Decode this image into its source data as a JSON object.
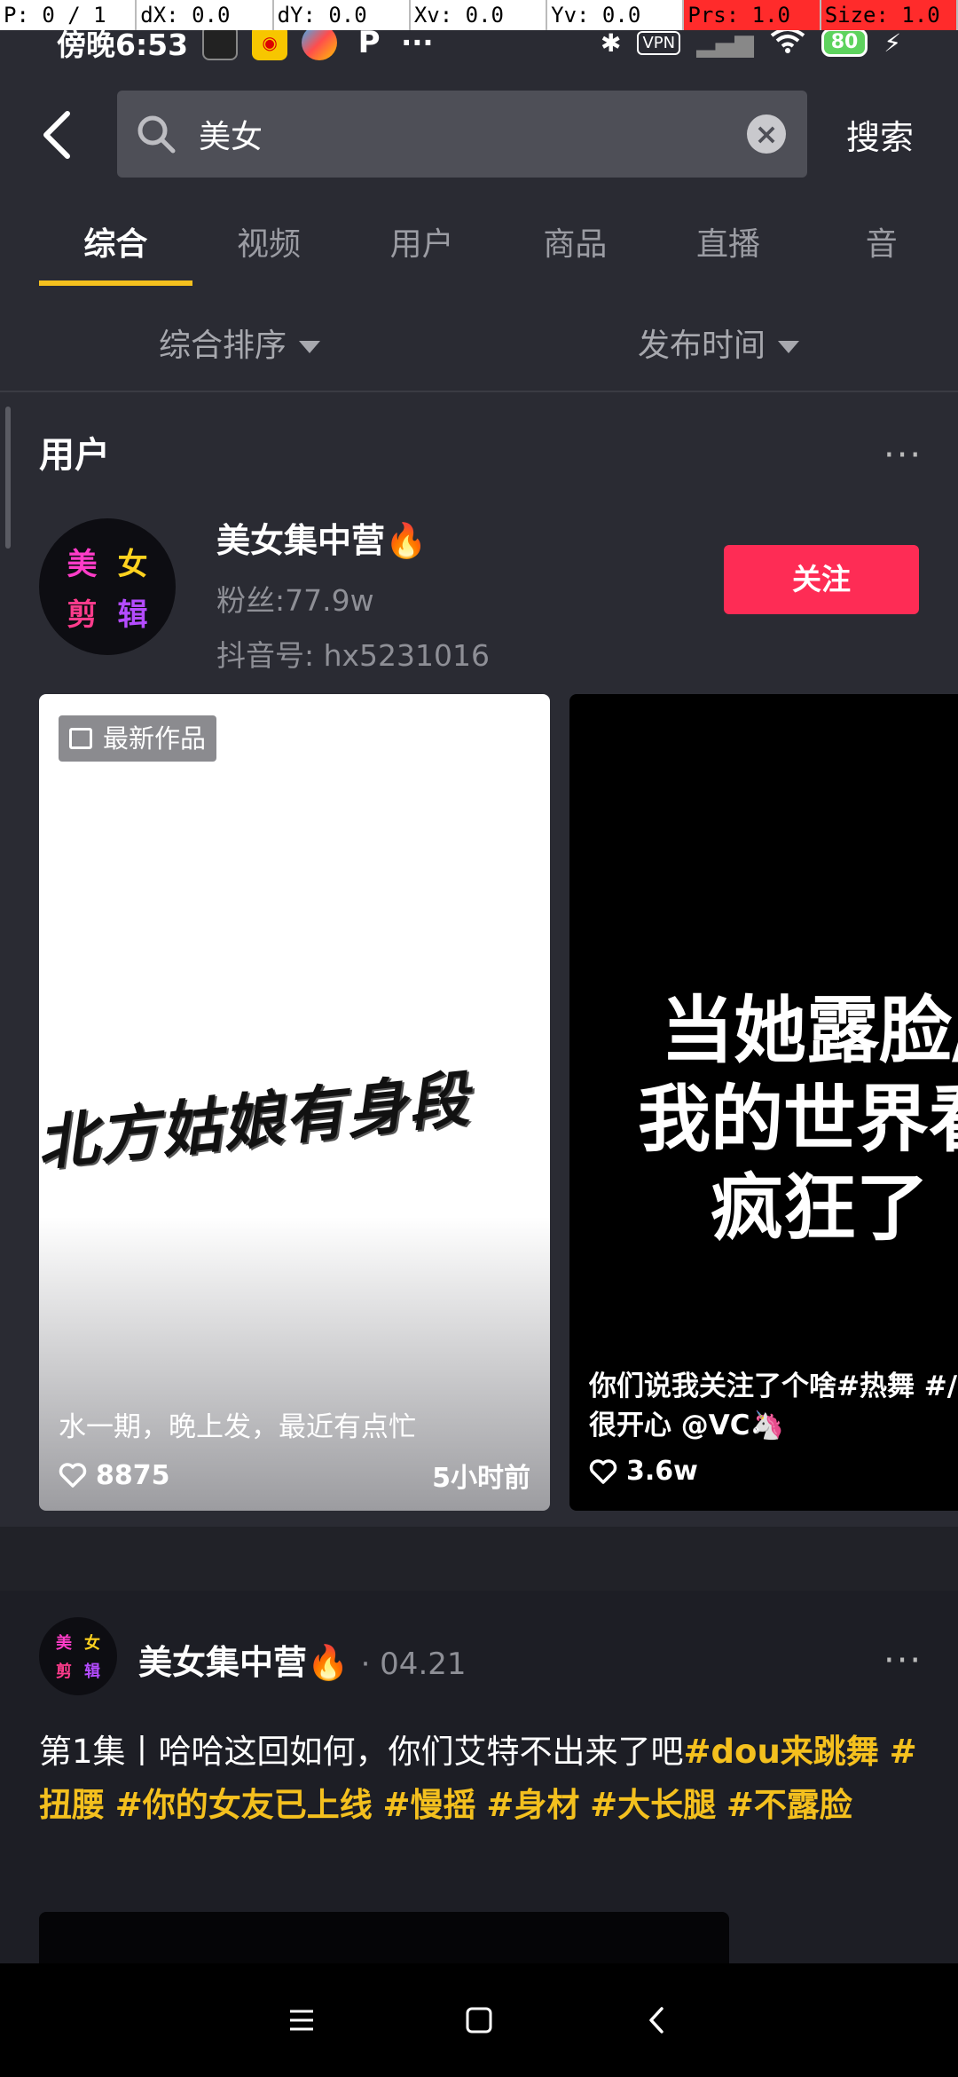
{
  "debug": {
    "p": "P: 0 / 1",
    "dx": "dX: 0.0",
    "dy": "dY: 0.0",
    "xv": "Xv: 0.0",
    "yv": "Yv: 0.0",
    "prs": "Prs: 1.0",
    "size": "Size: 1.0"
  },
  "status": {
    "time": "傍晚6:53",
    "vpn": "VPN",
    "battery": "80",
    "more": "···",
    "p_icon": "P"
  },
  "search": {
    "query": "美女",
    "submit_label": "搜索"
  },
  "tabs": [
    "综合",
    "视频",
    "用户",
    "商品",
    "直播",
    "音"
  ],
  "filters": {
    "sort": "综合排序",
    "time": "发布时间"
  },
  "users_section": {
    "title": "用户",
    "user": {
      "name": "美女集中营🔥",
      "fans": "粉丝:77.9w",
      "id": "抖音号: hx5231016",
      "follow_label": "关注",
      "avatar_chars": [
        "美",
        "女",
        "剪",
        "辑"
      ]
    },
    "cards": [
      {
        "badge": "最新作品",
        "overlay_text": "北方姑娘有身段",
        "caption": "水一期，晚上发，最近有点忙",
        "likes": "8875",
        "time": "5小时前"
      },
      {
        "overlay_lines": [
          "当她露脸/",
          "我的世界看",
          "疯狂了"
        ],
        "caption_line1": "你们说我关注了个啥#热舞 #/",
        "caption_line2": "很开心 @VC🦄",
        "likes": "3.6w"
      }
    ]
  },
  "post": {
    "author": "美女集中营🔥",
    "date": "· 04.21",
    "text_plain": "第1集丨哈哈这回如何，你们艾特不出来了吧",
    "tags": [
      "#dou来跳舞",
      "#扭腰",
      "#你的女友已上线",
      "#慢摇",
      "#身材",
      "#大长腿",
      "#不露脸"
    ]
  },
  "icons": {
    "back": "chevron-left-icon",
    "search": "search-icon",
    "clear": "clear-icon",
    "more": "more-horizontal-icon",
    "heart": "heart-icon",
    "nav_menu": "menu-icon",
    "nav_home": "home-square-icon",
    "nav_back": "back-triangle-icon"
  },
  "colors": {
    "background": "#2a2b33",
    "accent_yellow": "#f4c01e",
    "follow_red": "#fe2c55"
  }
}
